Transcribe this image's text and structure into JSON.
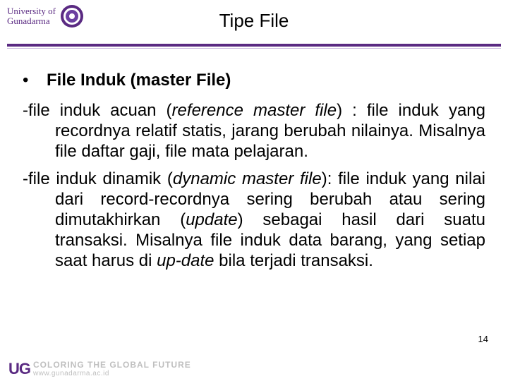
{
  "header": {
    "logo_line1": "University of",
    "logo_line2": "Gunadarma",
    "title": "Tipe File"
  },
  "content": {
    "bullet": "File Induk (master File)",
    "para1_prefix": "-file induk acuan (",
    "para1_italic": "reference master file",
    "para1_rest": ") : file induk yang recordnya relatif statis, jarang berubah nilainya. Misalnya file daftar gaji, file mata pelajaran.",
    "para2_prefix": "-file induk dinamik (",
    "para2_italic1": "dynamic master file",
    "para2_mid1": "): file induk yang nilai dari record-recordnya sering berubah atau sering dimutakhirkan (",
    "para2_italic2": "update",
    "para2_mid2": ") sebagai hasil dari suatu transaksi. Misalnya file induk data barang, yang setiap saat harus di ",
    "para2_italic3": "up-date",
    "para2_end": " bila terjadi transaksi."
  },
  "slide_number": "14",
  "footer": {
    "ug": "UG",
    "tagline": "COLORING THE GLOBAL FUTURE",
    "url": "www.gunadarma.ac.id"
  }
}
